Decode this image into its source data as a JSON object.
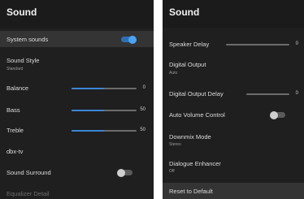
{
  "left": {
    "title": "Sound",
    "items": [
      {
        "label": "System sounds",
        "toggle": "on"
      },
      {
        "label": "Sound Style",
        "sub": "Standard"
      },
      {
        "label": "Balance",
        "value": "0",
        "level": 0.5
      },
      {
        "label": "Bass",
        "value": "50",
        "level": 0.5
      },
      {
        "label": "Treble",
        "value": "50",
        "level": 0.5
      },
      {
        "label": "dbx-tv"
      },
      {
        "label": "Sound Surround",
        "toggle": "off"
      },
      {
        "label": "Equalizer Detail"
      }
    ]
  },
  "right": {
    "title": "Sound",
    "items": [
      {
        "label": "Speaker Delay",
        "value": "0",
        "level": 0.0
      },
      {
        "label": "Digital Output",
        "sub": "Auto"
      },
      {
        "label": "Digital Output Delay",
        "value": "0",
        "level": 0.0
      },
      {
        "label": "Auto Volume Control",
        "toggle": "off"
      },
      {
        "label": "Downmix Mode",
        "sub": "Stereo"
      },
      {
        "label": "Dialogue Enhancer",
        "sub": "Off"
      },
      {
        "label": "Reset to Default"
      }
    ]
  },
  "colors": {
    "panel_bg": "#1f1f1f",
    "accent": "#3a86d4",
    "selected_row": "#343434"
  }
}
